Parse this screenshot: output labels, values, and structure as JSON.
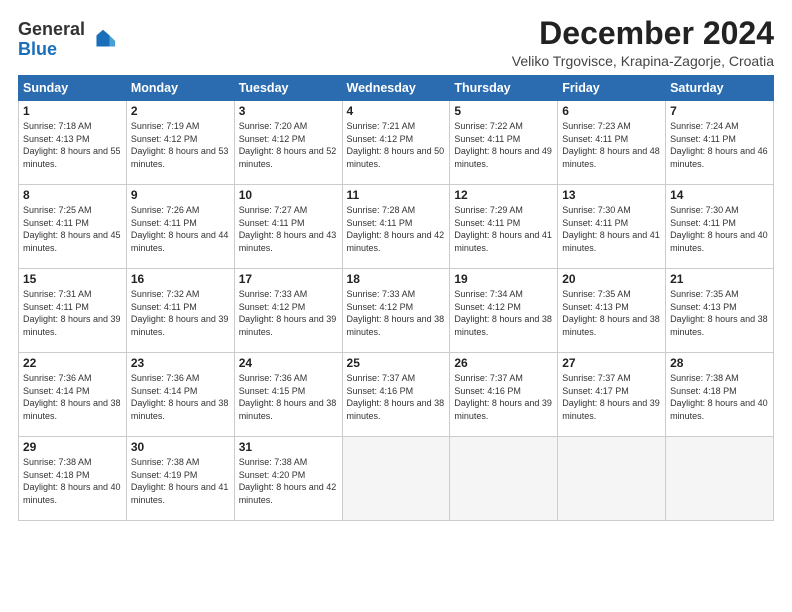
{
  "header": {
    "logo_general": "General",
    "logo_blue": "Blue",
    "month_title": "December 2024",
    "location": "Veliko Trgovisce, Krapina-Zagorje, Croatia"
  },
  "days_of_week": [
    "Sunday",
    "Monday",
    "Tuesday",
    "Wednesday",
    "Thursday",
    "Friday",
    "Saturday"
  ],
  "weeks": [
    [
      {
        "day": "1",
        "sunrise": "7:18 AM",
        "sunset": "4:13 PM",
        "daylight": "8 hours and 55 minutes."
      },
      {
        "day": "2",
        "sunrise": "7:19 AM",
        "sunset": "4:12 PM",
        "daylight": "8 hours and 53 minutes."
      },
      {
        "day": "3",
        "sunrise": "7:20 AM",
        "sunset": "4:12 PM",
        "daylight": "8 hours and 52 minutes."
      },
      {
        "day": "4",
        "sunrise": "7:21 AM",
        "sunset": "4:12 PM",
        "daylight": "8 hours and 50 minutes."
      },
      {
        "day": "5",
        "sunrise": "7:22 AM",
        "sunset": "4:11 PM",
        "daylight": "8 hours and 49 minutes."
      },
      {
        "day": "6",
        "sunrise": "7:23 AM",
        "sunset": "4:11 PM",
        "daylight": "8 hours and 48 minutes."
      },
      {
        "day": "7",
        "sunrise": "7:24 AM",
        "sunset": "4:11 PM",
        "daylight": "8 hours and 46 minutes."
      }
    ],
    [
      {
        "day": "8",
        "sunrise": "7:25 AM",
        "sunset": "4:11 PM",
        "daylight": "8 hours and 45 minutes."
      },
      {
        "day": "9",
        "sunrise": "7:26 AM",
        "sunset": "4:11 PM",
        "daylight": "8 hours and 44 minutes."
      },
      {
        "day": "10",
        "sunrise": "7:27 AM",
        "sunset": "4:11 PM",
        "daylight": "8 hours and 43 minutes."
      },
      {
        "day": "11",
        "sunrise": "7:28 AM",
        "sunset": "4:11 PM",
        "daylight": "8 hours and 42 minutes."
      },
      {
        "day": "12",
        "sunrise": "7:29 AM",
        "sunset": "4:11 PM",
        "daylight": "8 hours and 41 minutes."
      },
      {
        "day": "13",
        "sunrise": "7:30 AM",
        "sunset": "4:11 PM",
        "daylight": "8 hours and 41 minutes."
      },
      {
        "day": "14",
        "sunrise": "7:30 AM",
        "sunset": "4:11 PM",
        "daylight": "8 hours and 40 minutes."
      }
    ],
    [
      {
        "day": "15",
        "sunrise": "7:31 AM",
        "sunset": "4:11 PM",
        "daylight": "8 hours and 39 minutes."
      },
      {
        "day": "16",
        "sunrise": "7:32 AM",
        "sunset": "4:11 PM",
        "daylight": "8 hours and 39 minutes."
      },
      {
        "day": "17",
        "sunrise": "7:33 AM",
        "sunset": "4:12 PM",
        "daylight": "8 hours and 39 minutes."
      },
      {
        "day": "18",
        "sunrise": "7:33 AM",
        "sunset": "4:12 PM",
        "daylight": "8 hours and 38 minutes."
      },
      {
        "day": "19",
        "sunrise": "7:34 AM",
        "sunset": "4:12 PM",
        "daylight": "8 hours and 38 minutes."
      },
      {
        "day": "20",
        "sunrise": "7:35 AM",
        "sunset": "4:13 PM",
        "daylight": "8 hours and 38 minutes."
      },
      {
        "day": "21",
        "sunrise": "7:35 AM",
        "sunset": "4:13 PM",
        "daylight": "8 hours and 38 minutes."
      }
    ],
    [
      {
        "day": "22",
        "sunrise": "7:36 AM",
        "sunset": "4:14 PM",
        "daylight": "8 hours and 38 minutes."
      },
      {
        "day": "23",
        "sunrise": "7:36 AM",
        "sunset": "4:14 PM",
        "daylight": "8 hours and 38 minutes."
      },
      {
        "day": "24",
        "sunrise": "7:36 AM",
        "sunset": "4:15 PM",
        "daylight": "8 hours and 38 minutes."
      },
      {
        "day": "25",
        "sunrise": "7:37 AM",
        "sunset": "4:16 PM",
        "daylight": "8 hours and 38 minutes."
      },
      {
        "day": "26",
        "sunrise": "7:37 AM",
        "sunset": "4:16 PM",
        "daylight": "8 hours and 39 minutes."
      },
      {
        "day": "27",
        "sunrise": "7:37 AM",
        "sunset": "4:17 PM",
        "daylight": "8 hours and 39 minutes."
      },
      {
        "day": "28",
        "sunrise": "7:38 AM",
        "sunset": "4:18 PM",
        "daylight": "8 hours and 40 minutes."
      }
    ],
    [
      {
        "day": "29",
        "sunrise": "7:38 AM",
        "sunset": "4:18 PM",
        "daylight": "8 hours and 40 minutes."
      },
      {
        "day": "30",
        "sunrise": "7:38 AM",
        "sunset": "4:19 PM",
        "daylight": "8 hours and 41 minutes."
      },
      {
        "day": "31",
        "sunrise": "7:38 AM",
        "sunset": "4:20 PM",
        "daylight": "8 hours and 42 minutes."
      },
      null,
      null,
      null,
      null
    ]
  ]
}
